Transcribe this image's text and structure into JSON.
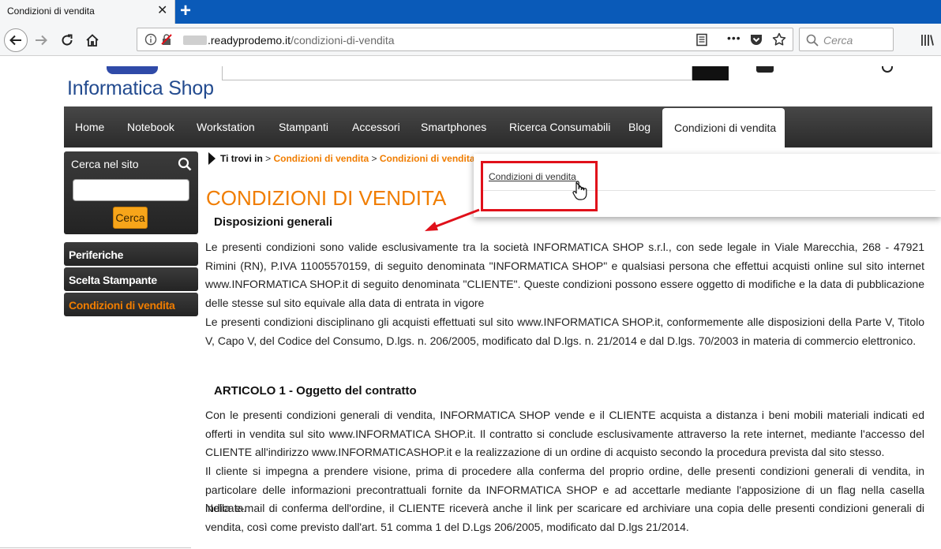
{
  "browser": {
    "tab_title": "Condizioni di vendita",
    "tab_close": "✕",
    "new_tab": "+",
    "url_host": ".readyprodemo.it",
    "url_path": "/condizioni-di-vendita",
    "search_placeholder": "Cerca",
    "page_actions": "•••"
  },
  "site": {
    "logo_text": "Informatica Shop"
  },
  "menu": {
    "items": [
      "Home",
      "Notebook",
      "Workstation",
      "Stampanti",
      "Accessori",
      "Smartphones",
      "Ricerca Consumabili",
      "Blog",
      "Condizioni di vendita"
    ]
  },
  "sidebar": {
    "search_title": "Cerca nel sito",
    "search_button": "Cerca",
    "items": [
      "Periferiche",
      "Scelta Stampante",
      "Condizioni di vendita"
    ]
  },
  "breadcrumb": {
    "prefix": "Ti trovi in",
    "links": [
      "Condizioni di vendita",
      "Condizioni di vendita"
    ]
  },
  "dropdown": {
    "link": "Condizioni di vendita"
  },
  "content": {
    "title": "CONDIZIONI DI VENDITA",
    "section1_heading": "Disposizioni generali",
    "section1_p1": "Le presenti condizioni sono valide esclusivamente tra la società INFORMATICA SHOP s.r.l., con sede legale in Viale Marecchia, 268 - 47921 Rimini (RN), P.IVA 11005570159, di seguito denominata \"INFORMATICA SHOP\" e qualsiasi persona che effettui acquisti online sul sito internet www.INFORMATICA SHOP.it di seguito denominata \"CLIENTE\". Queste condizioni possono essere oggetto di modifiche e la data di pubblicazione delle stesse sul sito equivale alla data di entrata in vigore",
    "section1_p2": "Le presenti condizioni disciplinano gli acquisti effettuati sul sito www.INFORMATICA SHOP.it, conformemente alle disposizioni della Parte V, Titolo V, Capo V, del Codice del Consumo, D.lgs. n. 206/2005, modificato dal D.lgs. n. 21/2014 e dal D.lgs. 70/2003 in materia di commercio elettronico.",
    "section2_heading": "ARTICOLO 1 - Oggetto del contratto",
    "section2_p1": "Con le presenti condizioni generali di vendita, INFORMATICA SHOP vende e il CLIENTE acquista a distanza i beni mobili materiali indicati ed offerti in vendita sul sito www.INFORMATICA SHOP.it. Il contratto si conclude esclusivamente attraverso la rete internet, mediante l'accesso del CLIENTE all'indirizzo www.INFORMATICASHOP.it e la realizzazione di un ordine di acquisto secondo la procedura prevista dal sito stesso.",
    "section2_p2": "Il cliente si impegna a prendere visione, prima di procedere alla conferma del proprio ordine, delle presenti condizioni generali di vendita, in particolare delle informazioni precontrattuali fornite da INFORMATICA SHOP e ad accettarle mediante l'apposizione di un flag nella casella indicata.",
    "section2_p3": "Nella e-mail di conferma dell'ordine, il CLIENTE riceverà anche il link per scaricare ed archiviare una copia delle presenti condizioni generali di vendita, così come previsto dall'art. 51 comma 1 del D.Lgs 206/2005, modificato dal D.lgs 21/2014."
  },
  "colors": {
    "accent_orange": "#f07d00",
    "annotation_red": "#e0101a",
    "browser_blue": "#0a5ab8"
  },
  "icons": [
    "back-arrow-icon",
    "forward-arrow-icon",
    "reload-icon",
    "home-icon",
    "info-icon",
    "insecure-lock-icon",
    "reader-view-icon",
    "pocket-icon",
    "bookmark-star-icon",
    "search-icon",
    "library-icon",
    "hand-cursor-icon",
    "red-arrow-icon"
  ]
}
